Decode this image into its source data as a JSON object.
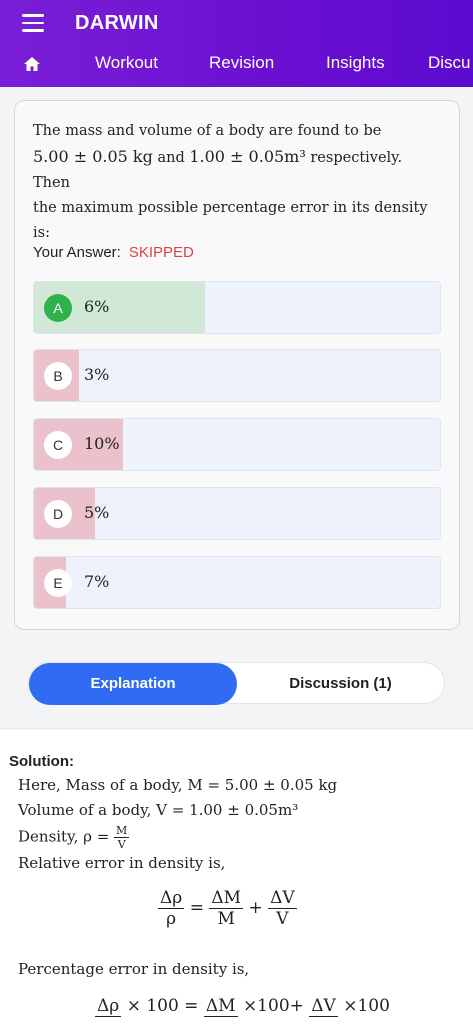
{
  "app": {
    "title": "DARWIN"
  },
  "icons": {
    "menu": "hamburger-menu-icon",
    "home": "home-icon"
  },
  "nav": {
    "tabs": [
      "Workout",
      "Revision",
      "Insights",
      "Discu"
    ]
  },
  "question": {
    "line1": "The mass and volume of a body are found to be",
    "line2_mass": "5.00 ± 0.05 kg",
    "line2_and": "and",
    "line2_volume": "1.00 ± 0.05m³",
    "line2_tail": "respectively. Then",
    "line3": "the maximum possible percentage error in its density is:"
  },
  "answer": {
    "label": "Your Answer:",
    "status": "SKIPPED"
  },
  "options": [
    {
      "letter": "A",
      "text": "6%",
      "fill_fraction": 0.42,
      "fill_color": "#d1e8d6",
      "correct": true
    },
    {
      "letter": "B",
      "text": "3%",
      "fill_fraction": 0.11,
      "fill_color": "#ebc1cc",
      "correct": false
    },
    {
      "letter": "C",
      "text": "10%",
      "fill_fraction": 0.22,
      "fill_color": "#ebc1cc",
      "correct": false
    },
    {
      "letter": "D",
      "text": "5%",
      "fill_fraction": 0.15,
      "fill_color": "#ebc1cc",
      "correct": false
    },
    {
      "letter": "E",
      "text": "7%",
      "fill_fraction": 0.08,
      "fill_color": "#ebc1cc",
      "correct": false
    }
  ],
  "toggle": {
    "explanation": "Explanation",
    "discussion": "Discussion (1)"
  },
  "solution": {
    "title": "Solution:",
    "mass_line": "Here, Mass of a body, M = 5.00 ± 0.05 kg",
    "volume_line": "Volume of a body, V = 1.00 ± 0.05m³",
    "density_prefix": "Density, ρ =",
    "density_num": "M",
    "density_den": "V",
    "relative_label": "Relative error in density is,",
    "eq1": {
      "lhs_num": "Δρ",
      "lhs_den": "ρ",
      "eq": "=",
      "t1_num": "ΔM",
      "t1_den": "M",
      "plus": "+",
      "t2_num": "ΔV",
      "t2_den": "V"
    },
    "percentage_label": "Percentage error in density is,",
    "eq2": {
      "lhs_num": "Δρ",
      "times1": "× 100 =",
      "t1_num": "ΔM",
      "times2": "×100+",
      "t2_num": "ΔV",
      "times3": "×100"
    }
  },
  "colors": {
    "header": "#6a0fd0",
    "accent": "#2f6bf3",
    "correct": "#2fb24c",
    "skipped": "#d64545"
  }
}
